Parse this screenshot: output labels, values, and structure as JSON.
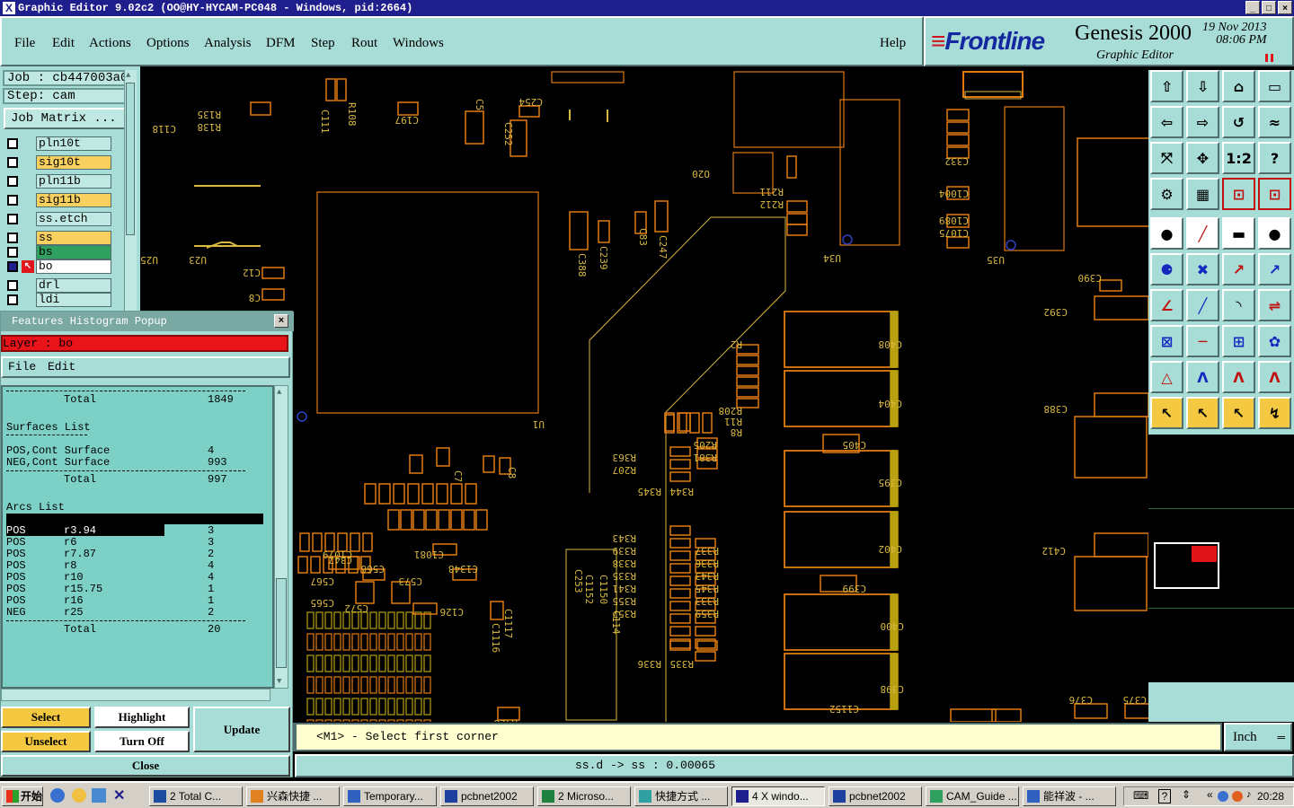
{
  "window": {
    "title": "Graphic Editor 9.02c2 (OO@HY-HYCAM-PC048 - Windows, pid:2664)"
  },
  "menu": [
    "File",
    "Edit",
    "Actions",
    "Options",
    "Analysis",
    "DFM",
    "Step",
    "Rout",
    "Windows"
  ],
  "help_label": "Help",
  "brand": {
    "logo": "Frontline",
    "product": "Genesis 2000",
    "subtitle": "Graphic Editor",
    "date": "19 Nov 2013",
    "time": "08:06 PM"
  },
  "job": {
    "job": "Job : cb447003a0",
    "step": "Step: cam",
    "matrix_button": "Job Matrix ..."
  },
  "layers": [
    {
      "name": "pln10t",
      "color": "#bfe8e2"
    },
    {
      "name": "sig10t",
      "color": "#f8d060"
    },
    {
      "name": "pln11b",
      "color": "#bfe8e2"
    },
    {
      "name": "sig11b",
      "color": "#f8d060"
    },
    {
      "name": "ss.etch",
      "color": "#bfe8e2"
    },
    {
      "name": "ss",
      "color": "#f8d060"
    },
    {
      "name": "bs",
      "color": "#30a060"
    },
    {
      "name": "bo",
      "color": "#ffffff"
    },
    {
      "name": "drl",
      "color": "#bfe8e2"
    },
    {
      "name": "ldi",
      "color": "#bfe8e2"
    }
  ],
  "popup": {
    "title": "Features Histogram Popup",
    "layer_label": "Layer :  bo",
    "menu": [
      "File",
      "Edit"
    ],
    "lines": [
      {
        "pol": "",
        "sym": "Total",
        "count": "1849",
        "sep": "above"
      },
      {
        "pol": "Surfaces List",
        "sym": "",
        "count": "",
        "head": true
      },
      {
        "pol": "POS,Cont Surface",
        "sym": "",
        "count": "4"
      },
      {
        "pol": "NEG,Cont Surface",
        "sym": "",
        "count": "993"
      },
      {
        "pol": "",
        "sym": "Total",
        "count": "997",
        "sep": "above"
      },
      {
        "pol": "Arcs List",
        "sym": "",
        "count": "",
        "head": true
      },
      {
        "pol": "POS",
        "sym": "r3.94",
        "count": "3",
        "sel": true
      },
      {
        "pol": "POS",
        "sym": "r6",
        "count": "3"
      },
      {
        "pol": "POS",
        "sym": "r7.87",
        "count": "2"
      },
      {
        "pol": "POS",
        "sym": "r8",
        "count": "4"
      },
      {
        "pol": "POS",
        "sym": "r10",
        "count": "4"
      },
      {
        "pol": "POS",
        "sym": "r15.75",
        "count": "1"
      },
      {
        "pol": "POS",
        "sym": "r16",
        "count": "1"
      },
      {
        "pol": "NEG",
        "sym": "r25",
        "count": "2"
      },
      {
        "pol": "",
        "sym": "Total",
        "count": "20",
        "sep": "above"
      }
    ],
    "buttons": {
      "select": "Select",
      "unselect": "Unselect",
      "highlight": "Highlight",
      "turn_off": "Turn Off",
      "update": "Update",
      "close": "Close"
    }
  },
  "command_prompt": "<M1> - Select first corner",
  "units": "Inch",
  "status_text": "ss.d -> ss : 0.00065",
  "taskbar": {
    "start": "开始",
    "tasks": [
      "2 Total C...",
      "兴森快捷 ...",
      "Temporary...",
      "pcbnet2002",
      "2 Microso...",
      "快捷方式 ...",
      "4 X windo...",
      "pcbnet2002",
      "CAM_Guide ...",
      "能祥波 - ..."
    ],
    "clock": "20:28"
  },
  "pcb_labels": [
    "R135",
    "R138",
    "C118",
    "C197",
    "C5",
    "C254",
    "C252",
    "U1",
    "U23",
    "U25",
    "C12",
    "C8",
    "C388",
    "C239",
    "C83",
    "C247",
    "O20",
    "C332",
    "C1004",
    "C1089",
    "C1075",
    "U34",
    "U35",
    "C390",
    "C392",
    "C408",
    "C404",
    "C405",
    "C395",
    "C402",
    "C399",
    "C400",
    "C398",
    "C412",
    "C386",
    "R211",
    "R212",
    "R2",
    "R6",
    "R11",
    "R208",
    "R205",
    "R381",
    "R363",
    "R207",
    "R345",
    "R344",
    "R343",
    "R339",
    "R338",
    "R335",
    "R341",
    "R355",
    "R357",
    "R337",
    "R336",
    "R343",
    "R345",
    "R333",
    "R359",
    "R335",
    "R336",
    "C7",
    "C8",
    "C53",
    "C150",
    "C1152",
    "C1150",
    "C114",
    "C1113",
    "C1117",
    "C1107",
    "C1081",
    "C1348",
    "C347",
    "C565",
    "C566",
    "C569",
    "C572",
    "C573",
    "C574",
    "C126",
    "C258",
    "C376",
    "C375",
    "C1152",
    "R428",
    "R429",
    "C1116"
  ]
}
